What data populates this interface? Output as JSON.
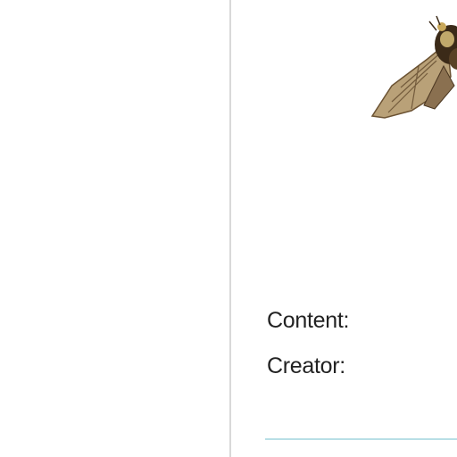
{
  "record": {
    "content_label": "Content:",
    "creator_label": "Creator:"
  },
  "image": {
    "icon": "moth-specimen-photo"
  },
  "colors": {
    "divider": "#d9d9d9",
    "rule": "#b8dfe6",
    "text": "#222222"
  }
}
